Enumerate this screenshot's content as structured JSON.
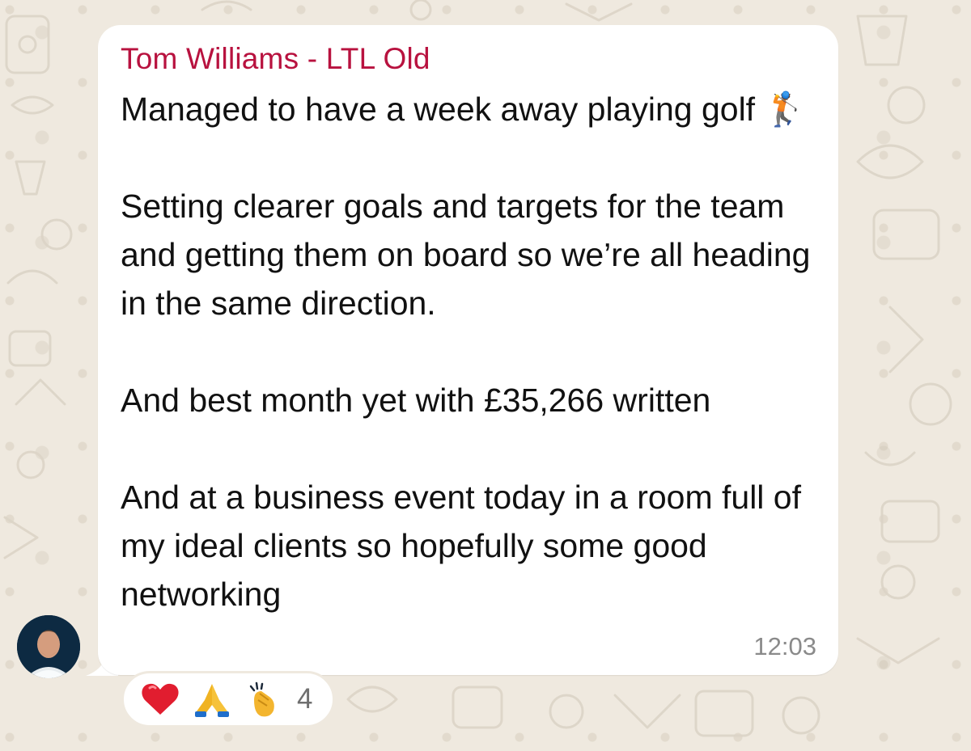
{
  "chat": {
    "sender": "Tom Williams - LTL Old",
    "message": "Managed to have a week away playing golf 🏌️\n\nSetting clearer goals and targets for the team and getting them on board so we’re all heading in the same direction.\n\nAnd best month yet with £35,266 written\n\nAnd at a business event today in a room full of my ideal clients so hopefully some good networking",
    "timestamp": "12:03",
    "avatar": "profile-photo",
    "reactions": {
      "items": [
        "❤️",
        "🙏",
        "👏"
      ],
      "count": "4"
    }
  },
  "colors": {
    "background": "#efe9df",
    "bubble": "#ffffff",
    "sender_name": "#b8123f",
    "message_text": "#111111",
    "timestamp": "#8a8a8a"
  }
}
